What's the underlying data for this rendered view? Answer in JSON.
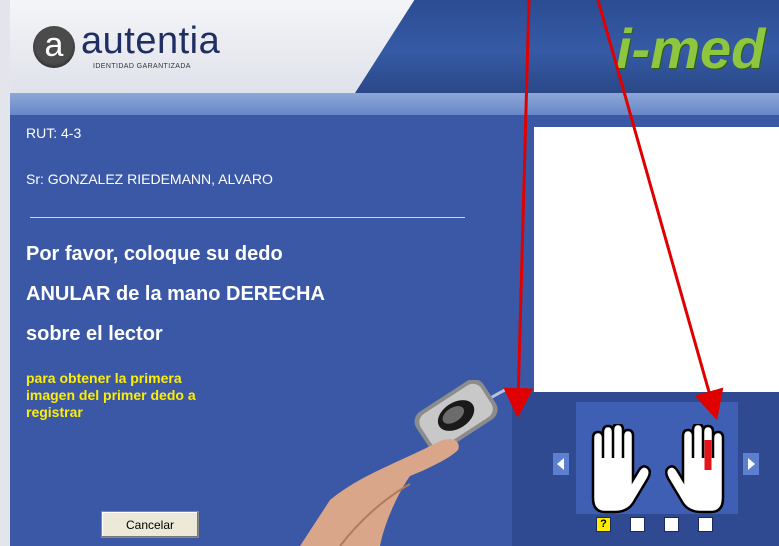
{
  "header": {
    "logo_letter": "a",
    "logo_word": "autentia",
    "logo_tagline": "IDENTIDAD GARANTIZADA",
    "brand": "i-med"
  },
  "patient": {
    "rut_line": "RUT:  4-3",
    "name_line": "Sr:  GONZALEZ RIEDEMANN, ALVARO"
  },
  "instruction": {
    "line1": "Por favor, coloque su dedo",
    "line2": "ANULAR de la mano DERECHA",
    "line3": "sobre el lector",
    "sub1": "para obtener la primera",
    "sub2": "imagen del primer dedo a",
    "sub3": "registrar"
  },
  "buttons": {
    "cancel": "Cancelar"
  },
  "finger_selector": {
    "selected_hand": "right",
    "selected_finger": "ring",
    "highlight_color": "#e3151a",
    "slots": [
      "?",
      "",
      "",
      ""
    ]
  },
  "colors": {
    "panel": "#3b58a6",
    "accent_yellow": "#ffee00",
    "annotation_arrow": "#e00000"
  },
  "icons": {
    "left_arrow": "chevron-left-icon",
    "right_arrow": "chevron-right-icon",
    "hand": "hand-icon"
  }
}
